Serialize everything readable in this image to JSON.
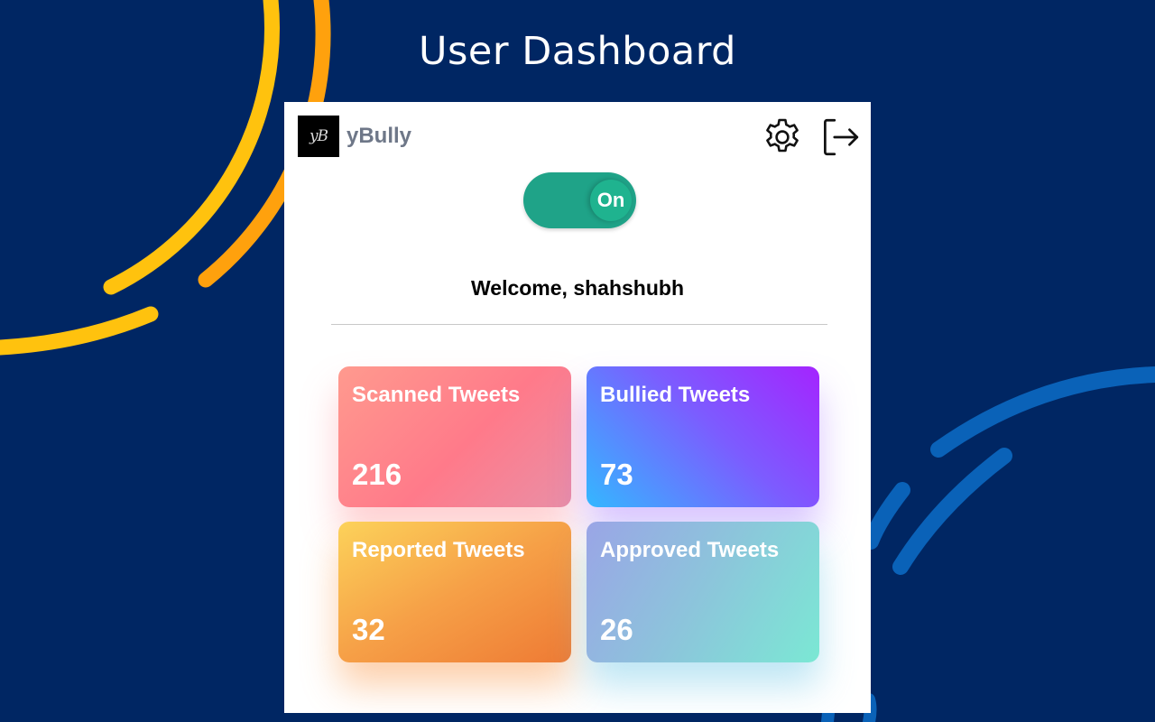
{
  "page": {
    "title": "User Dashboard"
  },
  "popup": {
    "logo_text": "yB",
    "brand_name": "yBully",
    "settings_icon": "gear-icon",
    "logout_icon": "logout-icon",
    "toggle": {
      "label": "On",
      "state": "on"
    },
    "welcome": "Welcome, shahshubh",
    "cards": [
      {
        "title": "Scanned Tweets",
        "value": "216"
      },
      {
        "title": "Bullied Tweets",
        "value": "73"
      },
      {
        "title": "Reported Tweets",
        "value": "32"
      },
      {
        "title": "Approved Tweets",
        "value": "26"
      }
    ]
  },
  "colors": {
    "background": "#002663",
    "toggle_on": "#1fa388",
    "accent_yellow": "#ffc20e",
    "accent_orange": "#ffa10d",
    "accent_blue": "#0a62b8"
  }
}
